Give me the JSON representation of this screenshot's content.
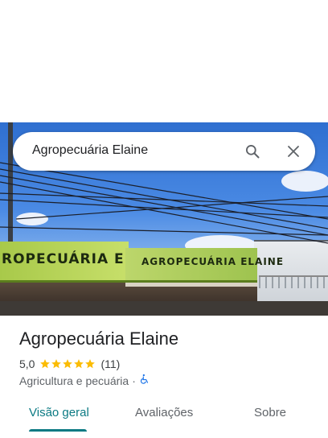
{
  "search": {
    "value": "Agropecuária Elaine",
    "search_icon": "search-icon",
    "close_icon": "close-icon"
  },
  "photo": {
    "banner_left_text": "ROPECUÁRIA ELAINE",
    "banner_right_text": "AGROPECUÁRIA ELAINE"
  },
  "place": {
    "name": "Agropecuária Elaine",
    "rating": "5,0",
    "stars_count": 5,
    "review_count": "(11)",
    "category": "Agricultura e pecuária",
    "separator": "·",
    "accessibility_icon": "wheelchair-icon"
  },
  "tabs": [
    {
      "label": "Visão geral",
      "active": true
    },
    {
      "label": "Avaliações",
      "active": false
    },
    {
      "label": "Sobre",
      "active": false
    }
  ],
  "colors": {
    "accent": "#0b7a83",
    "star": "#fbbc04",
    "accessibility": "#1a73e8"
  }
}
